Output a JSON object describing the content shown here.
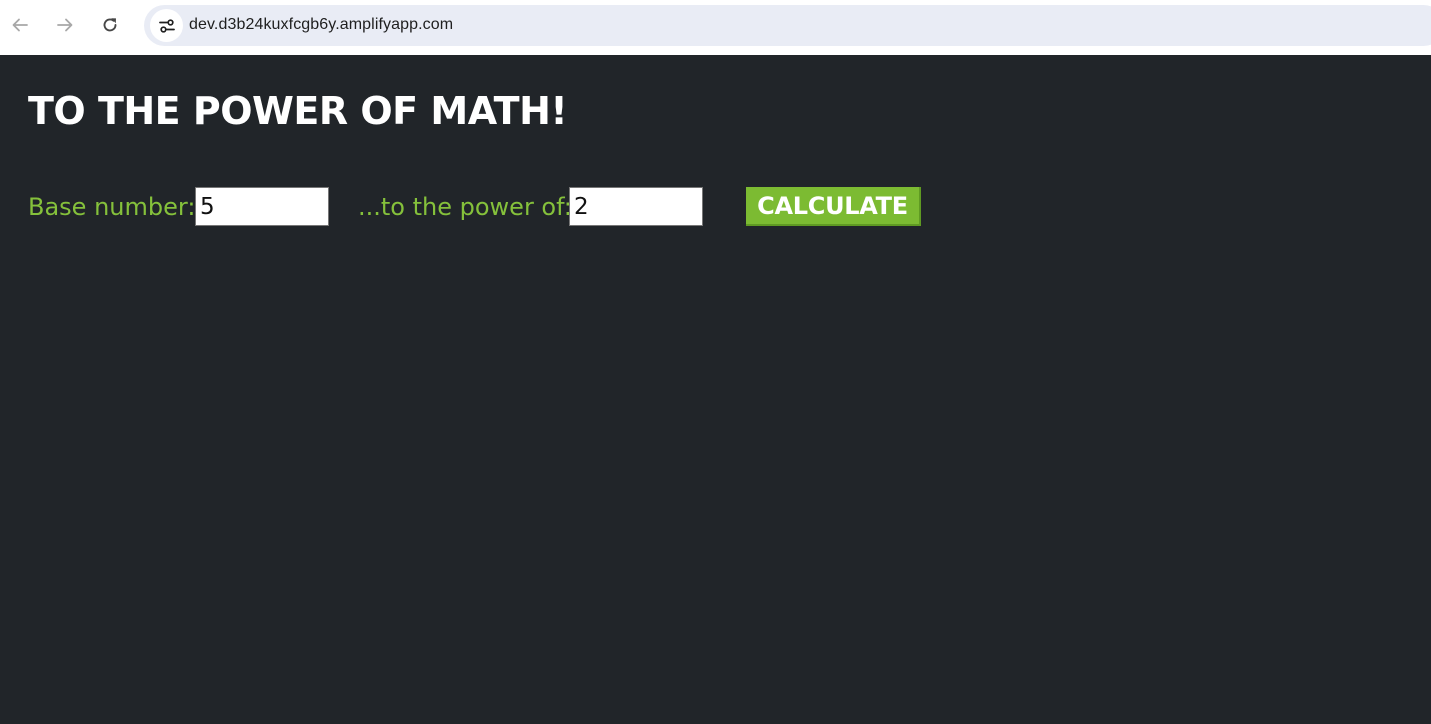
{
  "browser": {
    "url": "dev.d3b24kuxfcgb6y.amplifyapp.com"
  },
  "page": {
    "title": "TO THE POWER OF MATH!",
    "base_label": "Base number:",
    "base_value": "5",
    "power_label": "...to the power of:",
    "power_value": "2",
    "calculate_label": "CALCULATE"
  },
  "colors": {
    "background": "#212529",
    "label_green": "#85c13b",
    "button_green": "#7cbb32",
    "title_white": "#ffffff"
  },
  "icons": {
    "back": "arrow-left-icon",
    "forward": "arrow-right-icon",
    "reload": "reload-icon",
    "site_info": "tune-icon"
  }
}
